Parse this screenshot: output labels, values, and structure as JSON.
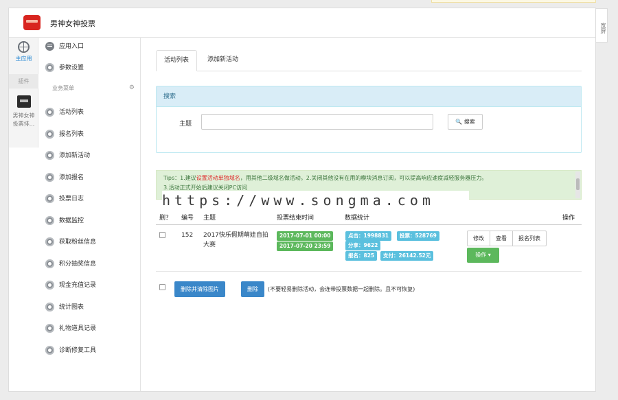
{
  "header": {
    "title": "男神女神投票",
    "wide_screen": "宽屏"
  },
  "rail": {
    "home_label": "主应用",
    "section": "插件",
    "app_label_1": "男神女神",
    "app_label_2": "投票排..."
  },
  "sidebar": {
    "top_items": [
      {
        "label": "应用入口",
        "icon": "chat-icon"
      },
      {
        "label": "参数设置",
        "icon": "gear-icon"
      }
    ],
    "section_title": "业务菜单",
    "items": [
      {
        "label": "活动列表",
        "icon": "gear-icon"
      },
      {
        "label": "报名列表",
        "icon": "gear-icon"
      },
      {
        "label": "添加新活动",
        "icon": "gear-icon"
      },
      {
        "label": "添加报名",
        "icon": "gear-icon"
      },
      {
        "label": "投票日志",
        "icon": "gear-icon"
      },
      {
        "label": "数据监控",
        "icon": "gear-icon"
      },
      {
        "label": "获取粉丝信息",
        "icon": "gear-icon"
      },
      {
        "label": "积分抽奖信息",
        "icon": "gear-icon"
      },
      {
        "label": "现金充值记录",
        "icon": "gear-icon"
      },
      {
        "label": "统计图表",
        "icon": "gear-icon"
      },
      {
        "label": "礼物道具记录",
        "icon": "gear-icon"
      },
      {
        "label": "诊断修复工具",
        "icon": "gear-icon"
      }
    ]
  },
  "tabs": [
    {
      "label": "活动列表",
      "active": true
    },
    {
      "label": "添加新活动",
      "active": false
    }
  ],
  "search": {
    "title": "搜索",
    "field_label": "主题",
    "value": "",
    "button": "搜索"
  },
  "tips": {
    "prefix": "Tips：1.建议",
    "highlight": "设置活动单独域名",
    "line1_rest": "，用其他二级域名做活动。2.关闭其他没有在用的模块消息订阅，可以提高响应速度减轻服务器压力。",
    "line2": "3.活动正式开始后建议关闭PC访问"
  },
  "watermark": "https://www.songma.com",
  "table": {
    "headers": {
      "del": "删？",
      "id": "编号",
      "subject": "主题",
      "time": "投票结束时间",
      "stats": "数据统计",
      "ops": "操作"
    },
    "row": {
      "id": "152",
      "subject": "2017快乐假期萌娃自拍大赛",
      "start": "2017-07-01 00:00",
      "end": "2017-07-20 23:59",
      "stats": {
        "clicks": "点击：1998831",
        "votes": "投票：528769",
        "shares": "分享：9622",
        "signups": "报名：825",
        "payment": "支付：26142.52元"
      },
      "buttons": {
        "edit": "修改",
        "view": "查看",
        "signup_list": "报名列表",
        "more": "操作 ▾"
      }
    }
  },
  "bottom": {
    "delete_clear": "删除并清除图片",
    "delete": "删除",
    "note": "(不要轻易删除活动，会连带投票数据一起删除。且不可恢复)"
  }
}
